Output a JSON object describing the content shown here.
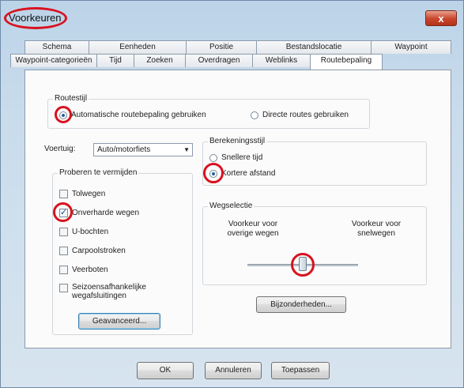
{
  "window": {
    "title": "Voorkeuren",
    "close_label": "x"
  },
  "tabs": {
    "row1": [
      "Schema",
      "Eenheden",
      "Positie",
      "Bestandslocatie",
      "Waypoint"
    ],
    "row2": [
      "Waypoint-categorieën",
      "Tijd",
      "Zoeken",
      "Overdragen",
      "Weblinks",
      "Routebepaling"
    ]
  },
  "routestijl": {
    "label": "Routestijl",
    "options": [
      "Automatische routebepaling gebruiken",
      "Directe routes gebruiken"
    ],
    "selected": 0
  },
  "voertuig": {
    "label": "Voertuig:",
    "value": "Auto/motorfiets"
  },
  "vermijden": {
    "label": "Proberen te vermijden",
    "items": [
      {
        "label": "Tolwegen",
        "checked": false
      },
      {
        "label": "Onverharde wegen",
        "checked": true
      },
      {
        "label": "U-bochten",
        "checked": false
      },
      {
        "label": "Carpoolstroken",
        "checked": false
      },
      {
        "label": "Veerboten",
        "checked": false
      },
      {
        "label": "Seizoensafhankelijke wegafsluitingen",
        "checked": false
      }
    ],
    "advanced_label": "Geavanceerd..."
  },
  "berekeningsstijl": {
    "label": "Berekeningsstijl",
    "options": [
      "Snellere tijd",
      "Kortere afstand"
    ],
    "selected": 1
  },
  "wegselectie": {
    "label": "Wegselectie",
    "left_label": "Voorkeur voor overige wegen",
    "right_label": "Voorkeur voor snelwegen",
    "value_fraction": 0.5
  },
  "bijzonderheden_label": "Bijzonderheden...",
  "footer": {
    "ok": "OK",
    "cancel": "Annuleren",
    "apply": "Toepassen"
  },
  "colors": {
    "highlight": "#d8121f",
    "accent": "#2c5f97"
  }
}
